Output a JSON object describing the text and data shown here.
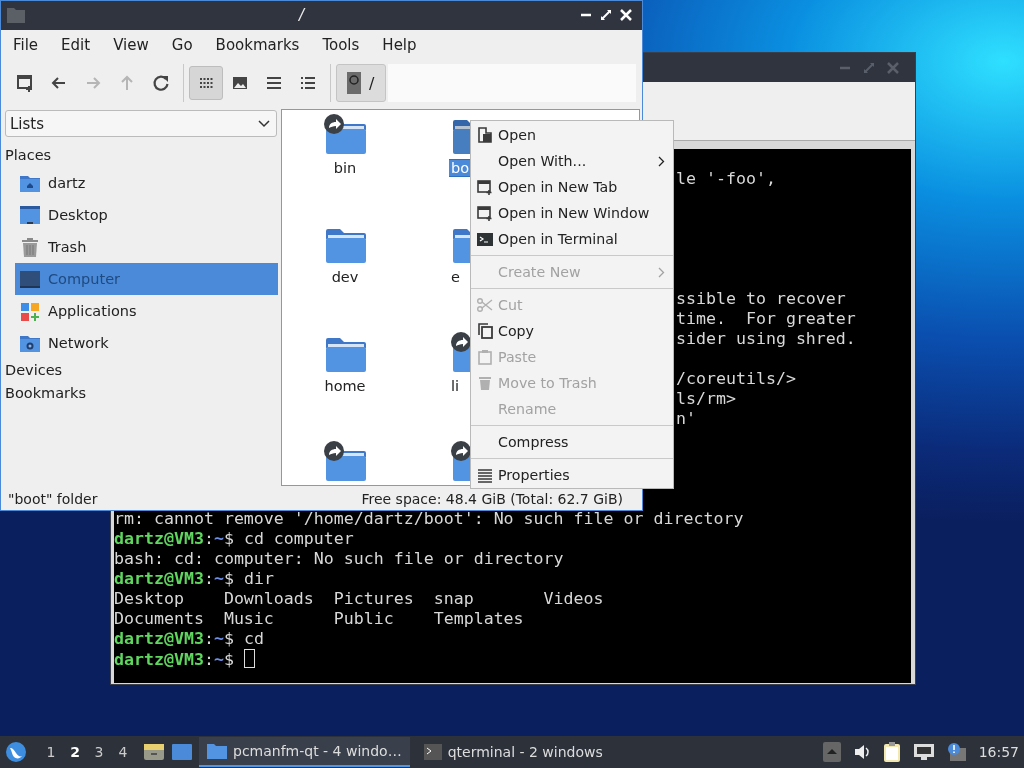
{
  "terminal_window": {
    "lines": [
      {
        "kind": "blank"
      },
      {
        "kind": "partial",
        "text": "le '-foo',"
      },
      {
        "kind": "blank"
      },
      {
        "kind": "blank"
      },
      {
        "kind": "blank"
      },
      {
        "kind": "blank"
      },
      {
        "kind": "blank"
      },
      {
        "kind": "partial",
        "text": "ssible to recover"
      },
      {
        "kind": "partial",
        "text": "time.  For greater"
      },
      {
        "kind": "partial",
        "text": "sider using shred."
      },
      {
        "kind": "blank"
      },
      {
        "kind": "partial",
        "text": "/coreutils/>"
      },
      {
        "kind": "partial",
        "text": "ls/rm>"
      },
      {
        "kind": "partial",
        "text": "n'"
      },
      {
        "kind": "blank"
      },
      {
        "kind": "blank"
      },
      {
        "kind": "blank"
      },
      {
        "kind": "blank"
      },
      {
        "kind": "output",
        "text": "rm: cannot remove '/home/dartz/boot': No such file or directory"
      },
      {
        "kind": "prompt",
        "user": "dartz@VM3",
        "colon": ":",
        "path": "~",
        "command": "$ cd computer"
      },
      {
        "kind": "output",
        "text": "bash: cd: computer: No such file or directory"
      },
      {
        "kind": "prompt",
        "user": "dartz@VM3",
        "colon": ":",
        "path": "~",
        "command": "$ dir"
      },
      {
        "kind": "output",
        "text": "Desktop    Downloads  Pictures  snap       Videos"
      },
      {
        "kind": "output",
        "text": "Documents  Music      Public    Templates"
      },
      {
        "kind": "prompt",
        "user": "dartz@VM3",
        "colon": ":",
        "path": "~",
        "command": "$ cd"
      },
      {
        "kind": "prompt",
        "user": "dartz@VM3",
        "colon": ":",
        "path": "~",
        "command": "$",
        "cursor": true
      }
    ]
  },
  "file_manager": {
    "title": "/",
    "menu": [
      "File",
      "Edit",
      "View",
      "Go",
      "Bookmarks",
      "Tools",
      "Help"
    ],
    "nav_buttons": [
      {
        "disabled": false
      },
      {
        "disabled": false
      },
      {
        "disabled": true
      },
      {
        "disabled": true
      },
      {
        "disabled": false
      }
    ],
    "view_buttons": [
      {
        "selected": true
      },
      {
        "selected": false
      },
      {
        "selected": false
      },
      {
        "selected": false
      }
    ],
    "path_button": {
      "label": "/",
      "selected": true
    },
    "side_panel": {
      "dropdown": "Lists",
      "sections": [
        {
          "title": "Places",
          "items": [
            {
              "label": "dartz",
              "selected": false
            },
            {
              "label": "Desktop",
              "selected": false
            },
            {
              "label": "Trash",
              "selected": false
            },
            {
              "label": "Computer",
              "selected": true
            },
            {
              "label": "Applications",
              "selected": false
            },
            {
              "label": "Network",
              "selected": false
            }
          ]
        },
        {
          "title": "Devices"
        },
        {
          "title": "Bookmarks"
        }
      ]
    },
    "files": [
      {
        "name": "bin",
        "link": true,
        "selected": false
      },
      {
        "name": "bo",
        "link": false,
        "selected": true
      },
      {
        "name": "dev",
        "link": false,
        "selected": false
      },
      {
        "name": "e",
        "link": false,
        "selected": false
      },
      {
        "name": "home",
        "link": false,
        "selected": false
      },
      {
        "name": "li",
        "link": true,
        "selected": false
      },
      {
        "link": true
      },
      {
        "link": true
      }
    ],
    "status_bar": {
      "selection": "\"boot\" folder",
      "free_space": "Free space: 48.4 GiB (Total: 62.7 GiB)"
    }
  },
  "context_menu": {
    "items": [
      {
        "kind": "item",
        "label": "Open",
        "disabled": false,
        "submenu": false
      },
      {
        "kind": "item",
        "label": "Open With...",
        "disabled": false,
        "submenu": true
      },
      {
        "kind": "item",
        "label": "Open in New Tab",
        "disabled": false,
        "submenu": false
      },
      {
        "kind": "item",
        "label": "Open in New Window",
        "disabled": false,
        "submenu": false
      },
      {
        "kind": "item",
        "label": "Open in Terminal",
        "disabled": false,
        "submenu": false
      },
      {
        "kind": "separator"
      },
      {
        "kind": "item",
        "label": "Create New",
        "disabled": true,
        "submenu": true
      },
      {
        "kind": "separator"
      },
      {
        "kind": "item",
        "label": "Cut",
        "disabled": true,
        "submenu": false
      },
      {
        "kind": "item",
        "label": "Copy",
        "disabled": false,
        "submenu": false
      },
      {
        "kind": "item",
        "label": "Paste",
        "disabled": true,
        "submenu": false
      },
      {
        "kind": "item",
        "label": "Move to Trash",
        "disabled": true,
        "submenu": false
      },
      {
        "kind": "item",
        "label": "Rename",
        "disabled": true,
        "submenu": false
      },
      {
        "kind": "separator"
      },
      {
        "kind": "item",
        "label": "Compress",
        "disabled": false,
        "submenu": false
      },
      {
        "kind": "separator"
      },
      {
        "kind": "item",
        "label": "Properties",
        "disabled": false,
        "submenu": false
      }
    ]
  },
  "taskbar": {
    "desktops": [
      {
        "label": "1",
        "selected": false
      },
      {
        "label": "2",
        "selected": true
      },
      {
        "label": "3",
        "selected": false
      },
      {
        "label": "4",
        "selected": false
      }
    ],
    "tasks": [
      {
        "label": "pcmanfm-qt - 4 windo…",
        "selected": true
      },
      {
        "label": "qterminal - 2 windows",
        "selected": false
      }
    ],
    "clock": "16:57"
  }
}
